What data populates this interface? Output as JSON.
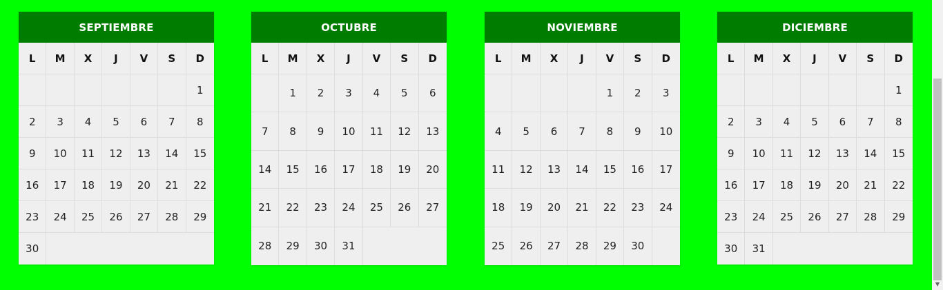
{
  "dow": [
    "L",
    "M",
    "X",
    "J",
    "V",
    "S",
    "D"
  ],
  "months": [
    {
      "name": "SEPTIEMBRE",
      "weeks": [
        [
          "",
          "",
          "",
          "",
          "",
          "",
          "1"
        ],
        [
          "2",
          "3",
          "4",
          "5",
          "6",
          "7",
          "8"
        ],
        [
          "9",
          "10",
          "11",
          "12",
          "13",
          "14",
          "15"
        ],
        [
          "16",
          "17",
          "18",
          "19",
          "20",
          "21",
          "22"
        ],
        [
          "23",
          "24",
          "25",
          "26",
          "27",
          "28",
          "29"
        ],
        [
          "30",
          "",
          "",
          "",
          "",
          "",
          ""
        ]
      ]
    },
    {
      "name": "OCTUBRE",
      "weeks": [
        [
          "",
          "1",
          "2",
          "3",
          "4",
          "5",
          "6"
        ],
        [
          "7",
          "8",
          "9",
          "10",
          "11",
          "12",
          "13"
        ],
        [
          "14",
          "15",
          "16",
          "17",
          "18",
          "19",
          "20"
        ],
        [
          "21",
          "22",
          "23",
          "24",
          "25",
          "26",
          "27"
        ],
        [
          "28",
          "29",
          "30",
          "31",
          "",
          "",
          ""
        ]
      ]
    },
    {
      "name": "NOVIEMBRE",
      "weeks": [
        [
          "",
          "",
          "",
          "",
          "1",
          "2",
          "3"
        ],
        [
          "4",
          "5",
          "6",
          "7",
          "8",
          "9",
          "10"
        ],
        [
          "11",
          "12",
          "13",
          "14",
          "15",
          "16",
          "17"
        ],
        [
          "18",
          "19",
          "20",
          "21",
          "22",
          "23",
          "24"
        ],
        [
          "25",
          "26",
          "27",
          "28",
          "29",
          "30",
          ""
        ]
      ]
    },
    {
      "name": "DICIEMBRE",
      "weeks": [
        [
          "",
          "",
          "",
          "",
          "",
          "",
          "1"
        ],
        [
          "2",
          "3",
          "4",
          "5",
          "6",
          "7",
          "8"
        ],
        [
          "9",
          "10",
          "11",
          "12",
          "13",
          "14",
          "15"
        ],
        [
          "16",
          "17",
          "18",
          "19",
          "20",
          "21",
          "22"
        ],
        [
          "23",
          "24",
          "25",
          "26",
          "27",
          "28",
          "29"
        ],
        [
          "30",
          "31",
          "",
          "",
          "",
          "",
          ""
        ]
      ]
    }
  ],
  "colors": {
    "background": "#00ff00",
    "header": "#007d00",
    "body": "#efefef"
  },
  "icons": {
    "scroll_down": "chevron-down-icon"
  }
}
